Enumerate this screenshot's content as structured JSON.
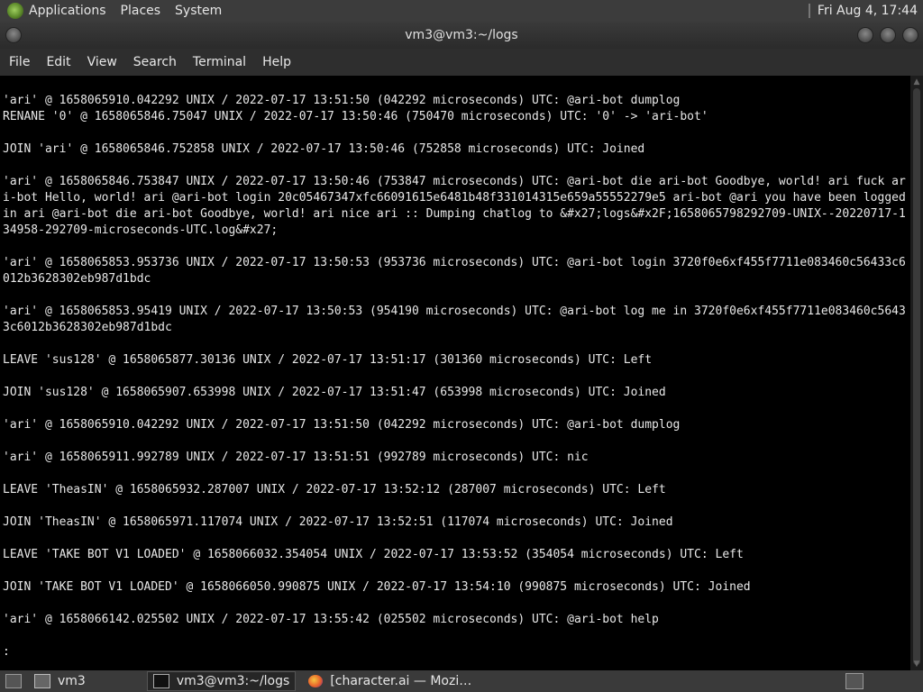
{
  "top_panel": {
    "menus": [
      "Applications",
      "Places",
      "System"
    ],
    "clock": "Fri Aug  4, 17:44"
  },
  "window": {
    "title": "vm3@vm3:~/logs"
  },
  "menubar": [
    "File",
    "Edit",
    "View",
    "Search",
    "Terminal",
    "Help"
  ],
  "terminal": {
    "lines": [
      "'ari' @ 1658065910.042292 UNIX / 2022-07-17 13:51:50 (042292 microseconds) UTC: @ari-bot dumplog",
      "RENANE '0' @ 1658065846.75047 UNIX / 2022-07-17 13:50:46 (750470 microseconds) UTC: '0' -> 'ari-bot'",
      "",
      "JOIN 'ari' @ 1658065846.752858 UNIX / 2022-07-17 13:50:46 (752858 microseconds) UTC: Joined",
      "",
      "'ari' @ 1658065846.753847 UNIX / 2022-07-17 13:50:46 (753847 microseconds) UTC: @ari-bot die ari-bot Goodbye, world! ari fuck ari-bot Hello, world! ari @ari-bot login 20c05467347xfc66091615e6481b48f331014315e659a55552279e5 ari-bot @ari you have been logged in ari @ari-bot die ari-bot Goodbye, world! ari nice ari :: Dumping chatlog to &#x27;logs&#x2F;1658065798292709-UNIX--20220717-134958-292709-microseconds-UTC.log&#x27;",
      "",
      "'ari' @ 1658065853.953736 UNIX / 2022-07-17 13:50:53 (953736 microseconds) UTC: @ari-bot login 3720f0e6xf455f7711e083460c56433c6012b3628302eb987d1bdc",
      "",
      "'ari' @ 1658065853.95419 UNIX / 2022-07-17 13:50:53 (954190 microseconds) UTC: @ari-bot log me in 3720f0e6xf455f7711e083460c56433c6012b3628302eb987d1bdc",
      "",
      "LEAVE 'sus128' @ 1658065877.30136 UNIX / 2022-07-17 13:51:17 (301360 microseconds) UTC: Left",
      "",
      "JOIN 'sus128' @ 1658065907.653998 UNIX / 2022-07-17 13:51:47 (653998 microseconds) UTC: Joined",
      "",
      "'ari' @ 1658065910.042292 UNIX / 2022-07-17 13:51:50 (042292 microseconds) UTC: @ari-bot dumplog",
      "",
      "'ari' @ 1658065911.992789 UNIX / 2022-07-17 13:51:51 (992789 microseconds) UTC: nic",
      "",
      "LEAVE 'TheasIN' @ 1658065932.287007 UNIX / 2022-07-17 13:52:12 (287007 microseconds) UTC: Left",
      "",
      "JOIN 'TheasIN' @ 1658065971.117074 UNIX / 2022-07-17 13:52:51 (117074 microseconds) UTC: Joined",
      "",
      "LEAVE 'TAKE BOT V1 LOADED' @ 1658066032.354054 UNIX / 2022-07-17 13:53:52 (354054 microseconds) UTC: Left",
      "",
      "JOIN 'TAKE BOT V1 LOADED' @ 1658066050.990875 UNIX / 2022-07-17 13:54:10 (990875 microseconds) UTC: Joined",
      "",
      "'ari' @ 1658066142.025502 UNIX / 2022-07-17 13:55:42 (025502 microseconds) UTC: @ari-bot help",
      "",
      ":"
    ]
  },
  "taskbar": {
    "tasks": [
      {
        "label": "vm3",
        "icon": "home-folder-icon"
      },
      {
        "label": "vm3@vm3:~/logs",
        "icon": "terminal-icon"
      },
      {
        "label": "[character.ai — Mozi…",
        "icon": "firefox-icon"
      }
    ]
  }
}
